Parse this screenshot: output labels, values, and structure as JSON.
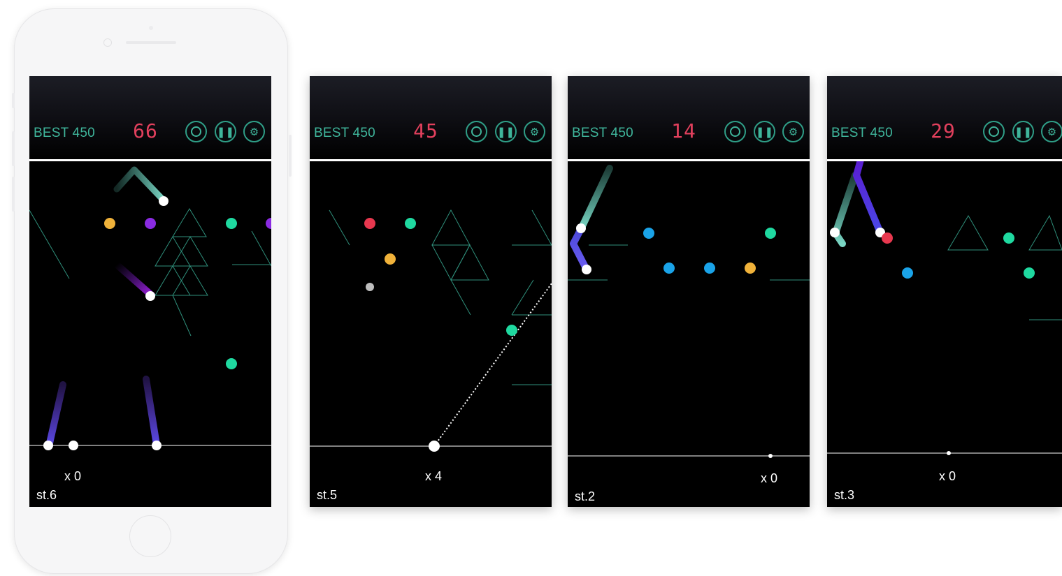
{
  "screens": [
    {
      "best": "BEST 450",
      "score": "66",
      "multiplier": "x 0",
      "stage": "st.6"
    },
    {
      "best": "BEST 450",
      "score": "45",
      "multiplier": "x 4",
      "stage": "st.5"
    },
    {
      "best": "BEST 450",
      "score": "14",
      "multiplier": "x 0",
      "stage": "st.2"
    },
    {
      "best": "BEST 450",
      "score": "29",
      "multiplier": "x 0",
      "stage": "st.3"
    }
  ],
  "hud_buttons": [
    "target-icon",
    "pause-icon",
    "settings-icon"
  ],
  "colors": {
    "accent_green": "#3fb59b",
    "score_red": "#e2405d",
    "orb_yellow": "#f0b23a",
    "orb_purple": "#8a2be2",
    "orb_green": "#1fd9a0",
    "orb_red": "#e8384f",
    "orb_blue": "#1aa3e8"
  }
}
